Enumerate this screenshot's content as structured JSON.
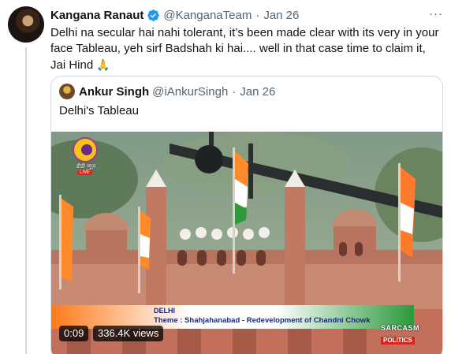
{
  "tweet": {
    "author_name": "Kangana Ranaut",
    "handle": "@KanganaTeam",
    "separator": "·",
    "date": "Jan 26",
    "more": "···",
    "text": "Delhi na secular hai nahi tolerant, it’s been made clear with its very in your face Tableau, yeh sirf Badshah ki hai.... well in that case time to claim it, Jai Hind",
    "emoji": "🙏"
  },
  "quoted": {
    "author_name": "Ankur Singh",
    "handle": "@iAnkurSingh",
    "separator": "·",
    "date": "Jan 26",
    "text": "Delhi's Tableau",
    "video": {
      "elapsed": "0:09",
      "views": "336.4K views",
      "channel_hindi": "डीडी न्यूज़",
      "live_label": "LIVE",
      "ticker_city": "DELHI",
      "ticker_theme": "Theme : Shahjahanabad - Redevelopment of Chandni Chowk",
      "watermark_top": "SARCASM",
      "watermark_bottom": "POLITICS"
    }
  },
  "colors": {
    "verified": "#1d9bf0",
    "text": "#0f1419",
    "muted": "#536471",
    "border": "#cfd9de"
  },
  "icons": [
    "verified-badge-icon",
    "more-icon",
    "folded-hands-emoji"
  ]
}
